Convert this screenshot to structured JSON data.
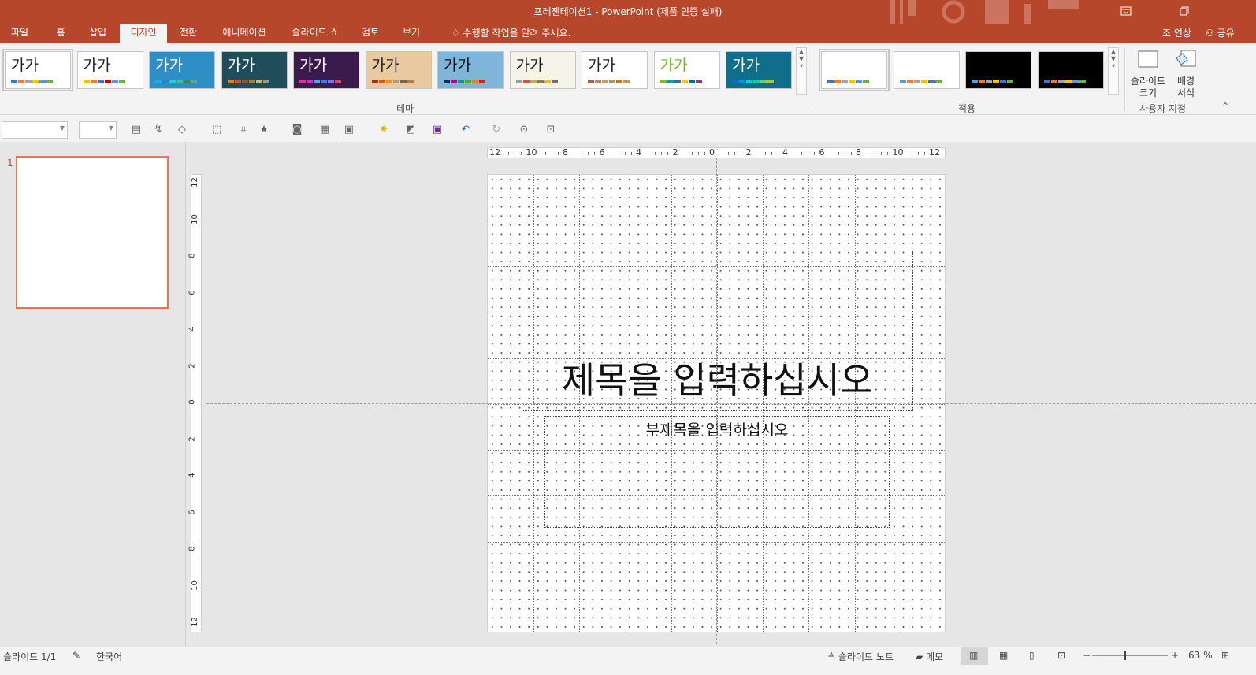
{
  "window": {
    "title": "프레젠테이션1 - PowerPoint (제품 인증 실패)",
    "restore_icon": "restore-icon",
    "ribbon_display_icon": "ribbon-display-icon"
  },
  "tabs": [
    "파일",
    "홈",
    "삽입",
    "디자인",
    "전환",
    "애니메이션",
    "슬라이드 쇼",
    "검토",
    "보기"
  ],
  "active_tab": "디자인",
  "tell_me": "수행할 작업을 알려 주세요.",
  "user": "조 연상",
  "share": "공유",
  "themes": {
    "label": "테마",
    "sample": "가가",
    "items": [
      {
        "bg": "#ffffff",
        "fg": "#222222",
        "bars": [
          "#4472c4",
          "#ed7d31",
          "#a5a5a5",
          "#ffc000",
          "#5b9bd5",
          "#70ad47"
        ]
      },
      {
        "bg": "#ffffff",
        "fg": "#222222",
        "bars": [
          "#ffc000",
          "#ed7d31",
          "#4472c4",
          "#c00000",
          "#5b9bd5",
          "#70ad47"
        ]
      },
      {
        "bg": "#2e8fc7",
        "fg": "#ffffff",
        "bars": [
          "#1cade4",
          "#2683c6",
          "#27ced7",
          "#42ba97",
          "#3e8853",
          "#62a39f"
        ]
      },
      {
        "bg": "#1f4e5a",
        "fg": "#ffffff",
        "bars": [
          "#e48312",
          "#bd582c",
          "#865640",
          "#9b8357",
          "#c2bc80",
          "#94a088"
        ]
      },
      {
        "bg": "#3b1a4c",
        "fg": "#ffffff",
        "bars": [
          "#e32d91",
          "#c830cc",
          "#4ea6dc",
          "#4775e7",
          "#8971e1",
          "#d54773"
        ]
      },
      {
        "bg": "#e8c9a0",
        "fg": "#222222",
        "bars": [
          "#a5300f",
          "#d55816",
          "#e19825",
          "#b19c7d",
          "#7f5f52",
          "#b27d49"
        ]
      },
      {
        "bg": "#7fb5d8",
        "fg": "#111111",
        "bars": [
          "#052f61",
          "#a50e82",
          "#14967c",
          "#6a9e1f",
          "#e87d37",
          "#c62324"
        ]
      },
      {
        "bg": "#f4f4e8",
        "fg": "#222222",
        "bars": [
          "#93a299",
          "#cf543f",
          "#b5ae53",
          "#848058",
          "#e8b54d",
          "#786c71"
        ]
      },
      {
        "bg": "#ffffff",
        "fg": "#222222",
        "bars": [
          "#a5644e",
          "#b58b80",
          "#c3986d",
          "#a19574",
          "#c17529",
          "#c19859"
        ]
      },
      {
        "bg": "#ffffff",
        "fg": "#7cb82f",
        "bars": [
          "#7cb82f",
          "#00a2b1",
          "#4c6a81",
          "#f1c33b",
          "#00718f",
          "#7c3e93"
        ]
      },
      {
        "bg": "#0f6e8a",
        "fg": "#ffffff",
        "bars": [
          "#0f6fc6",
          "#009dd9",
          "#0bd0d9",
          "#10cf9b",
          "#7cca62",
          "#a5c249"
        ]
      }
    ]
  },
  "variants": {
    "label": "적용",
    "items": [
      {
        "bg": "#ffffff",
        "bars": [
          "#4472c4",
          "#ed7d31",
          "#a5a5a5",
          "#ffc000",
          "#5b9bd5",
          "#70ad47"
        ]
      },
      {
        "bg": "#ffffff",
        "bars": [
          "#5b9bd5",
          "#ed7d31",
          "#a5a5a5",
          "#ffc000",
          "#4472c4",
          "#70ad47"
        ]
      },
      {
        "bg": "#000000",
        "bars": [
          "#5b9bd5",
          "#ed7d31",
          "#a5a5a5",
          "#ffc000",
          "#4472c4",
          "#70ad47"
        ]
      },
      {
        "bg": "#000000",
        "bars": [
          "#4472c4",
          "#ed7d31",
          "#a5a5a5",
          "#ffc000",
          "#5b9bd5",
          "#70ad47"
        ]
      }
    ]
  },
  "customize": {
    "label": "사용자 지정",
    "slide_size": "슬라이드\n크기",
    "format_bg": "배경\n서식"
  },
  "ruler": {
    "h_ticks": [
      "12",
      "10",
      "8",
      "6",
      "4",
      "2",
      "0",
      "2",
      "4",
      "6",
      "8",
      "10",
      "12"
    ],
    "v_ticks": [
      "12",
      "10",
      "8",
      "6",
      "4",
      "2",
      "0",
      "2",
      "4",
      "6",
      "8",
      "10",
      "12"
    ]
  },
  "slide": {
    "number": "1",
    "title": "제목을 입력하십시오",
    "subtitle": "부제목을 입력하십시오"
  },
  "status": {
    "slide_pos": "슬라이드 1/1",
    "language": "한국어",
    "notes": "슬라이드 노트",
    "comments": "메모",
    "zoom": "63 %",
    "zoom_level": 0.42
  }
}
